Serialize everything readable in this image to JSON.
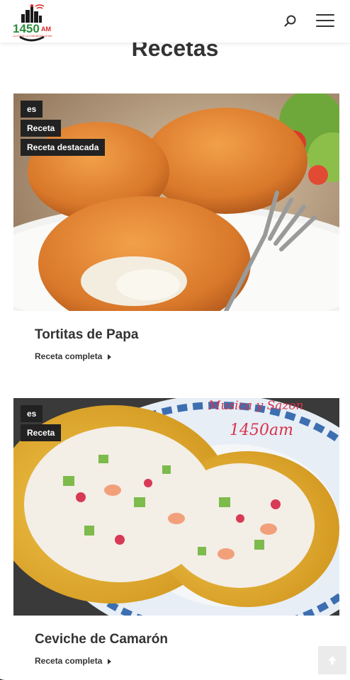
{
  "header": {
    "logo_text": "1450 AM",
    "logo_tagline": "LA VOZ DE LA COMUNIDAD LATINA"
  },
  "page": {
    "title": "Recetas"
  },
  "posts": [
    {
      "badges": [
        "es",
        "Receta",
        "Receta destacada"
      ],
      "title": "Tortitas de Papa",
      "read_more": "Receta completa"
    },
    {
      "badges": [
        "es",
        "Receta"
      ],
      "title": "Ceviche de Camarón",
      "read_more": "Receta completa",
      "image_watermark": [
        "Musica y Sazon",
        "1450am"
      ]
    }
  ],
  "icons": {
    "search": "search-icon",
    "menu": "hamburger-menu-icon",
    "back_to_top": "arrow-up-icon",
    "read_more": "caret-right-icon"
  },
  "colors": {
    "text": "#333333",
    "badge_bg": "#222222",
    "logo_green": "#2e8b3a",
    "logo_red": "#d62828"
  }
}
